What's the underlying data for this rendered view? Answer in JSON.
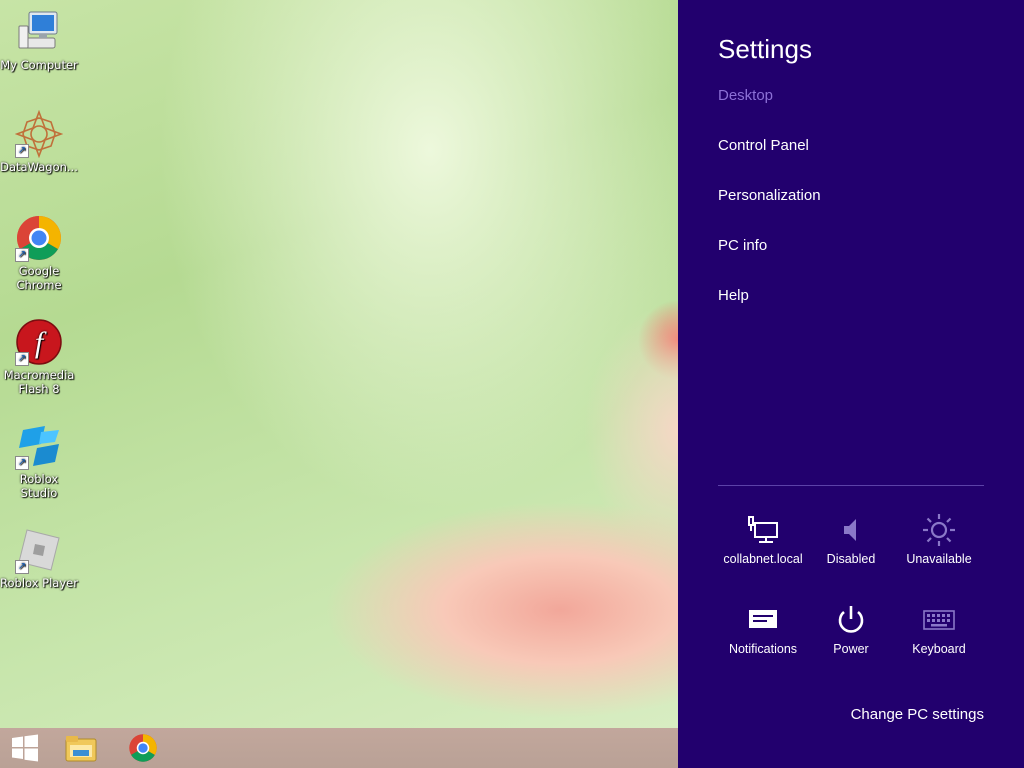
{
  "desktop": {
    "icons": [
      {
        "label": "My Computer",
        "icon": "computer-icon"
      },
      {
        "label": "DataWagon...",
        "icon": "datawagon-icon"
      },
      {
        "label": "Google Chrome",
        "icon": "chrome-icon"
      },
      {
        "label": "Macromedia Flash 8",
        "icon": "flash-icon"
      },
      {
        "label": "Roblox Studio",
        "icon": "roblox-studio-icon"
      },
      {
        "label": "Roblox Player",
        "icon": "roblox-player-icon"
      }
    ]
  },
  "taskbar": {
    "items": [
      "start-button",
      "file-explorer-icon",
      "chrome-icon"
    ],
    "color": "#bca399"
  },
  "settings": {
    "title": "Settings",
    "context": "Desktop",
    "links": [
      "Control Panel",
      "Personalization",
      "PC info",
      "Help"
    ],
    "quick_tiles": [
      {
        "label": "collabnet.local",
        "icon": "network-icon"
      },
      {
        "label": "Disabled",
        "icon": "volume-icon"
      },
      {
        "label": "Unavailable",
        "icon": "brightness-icon"
      },
      {
        "label": "Notifications",
        "icon": "notifications-icon"
      },
      {
        "label": "Power",
        "icon": "power-icon"
      },
      {
        "label": "Keyboard",
        "icon": "keyboard-icon"
      }
    ],
    "footer_link": "Change PC settings",
    "accent": "#22006e"
  }
}
